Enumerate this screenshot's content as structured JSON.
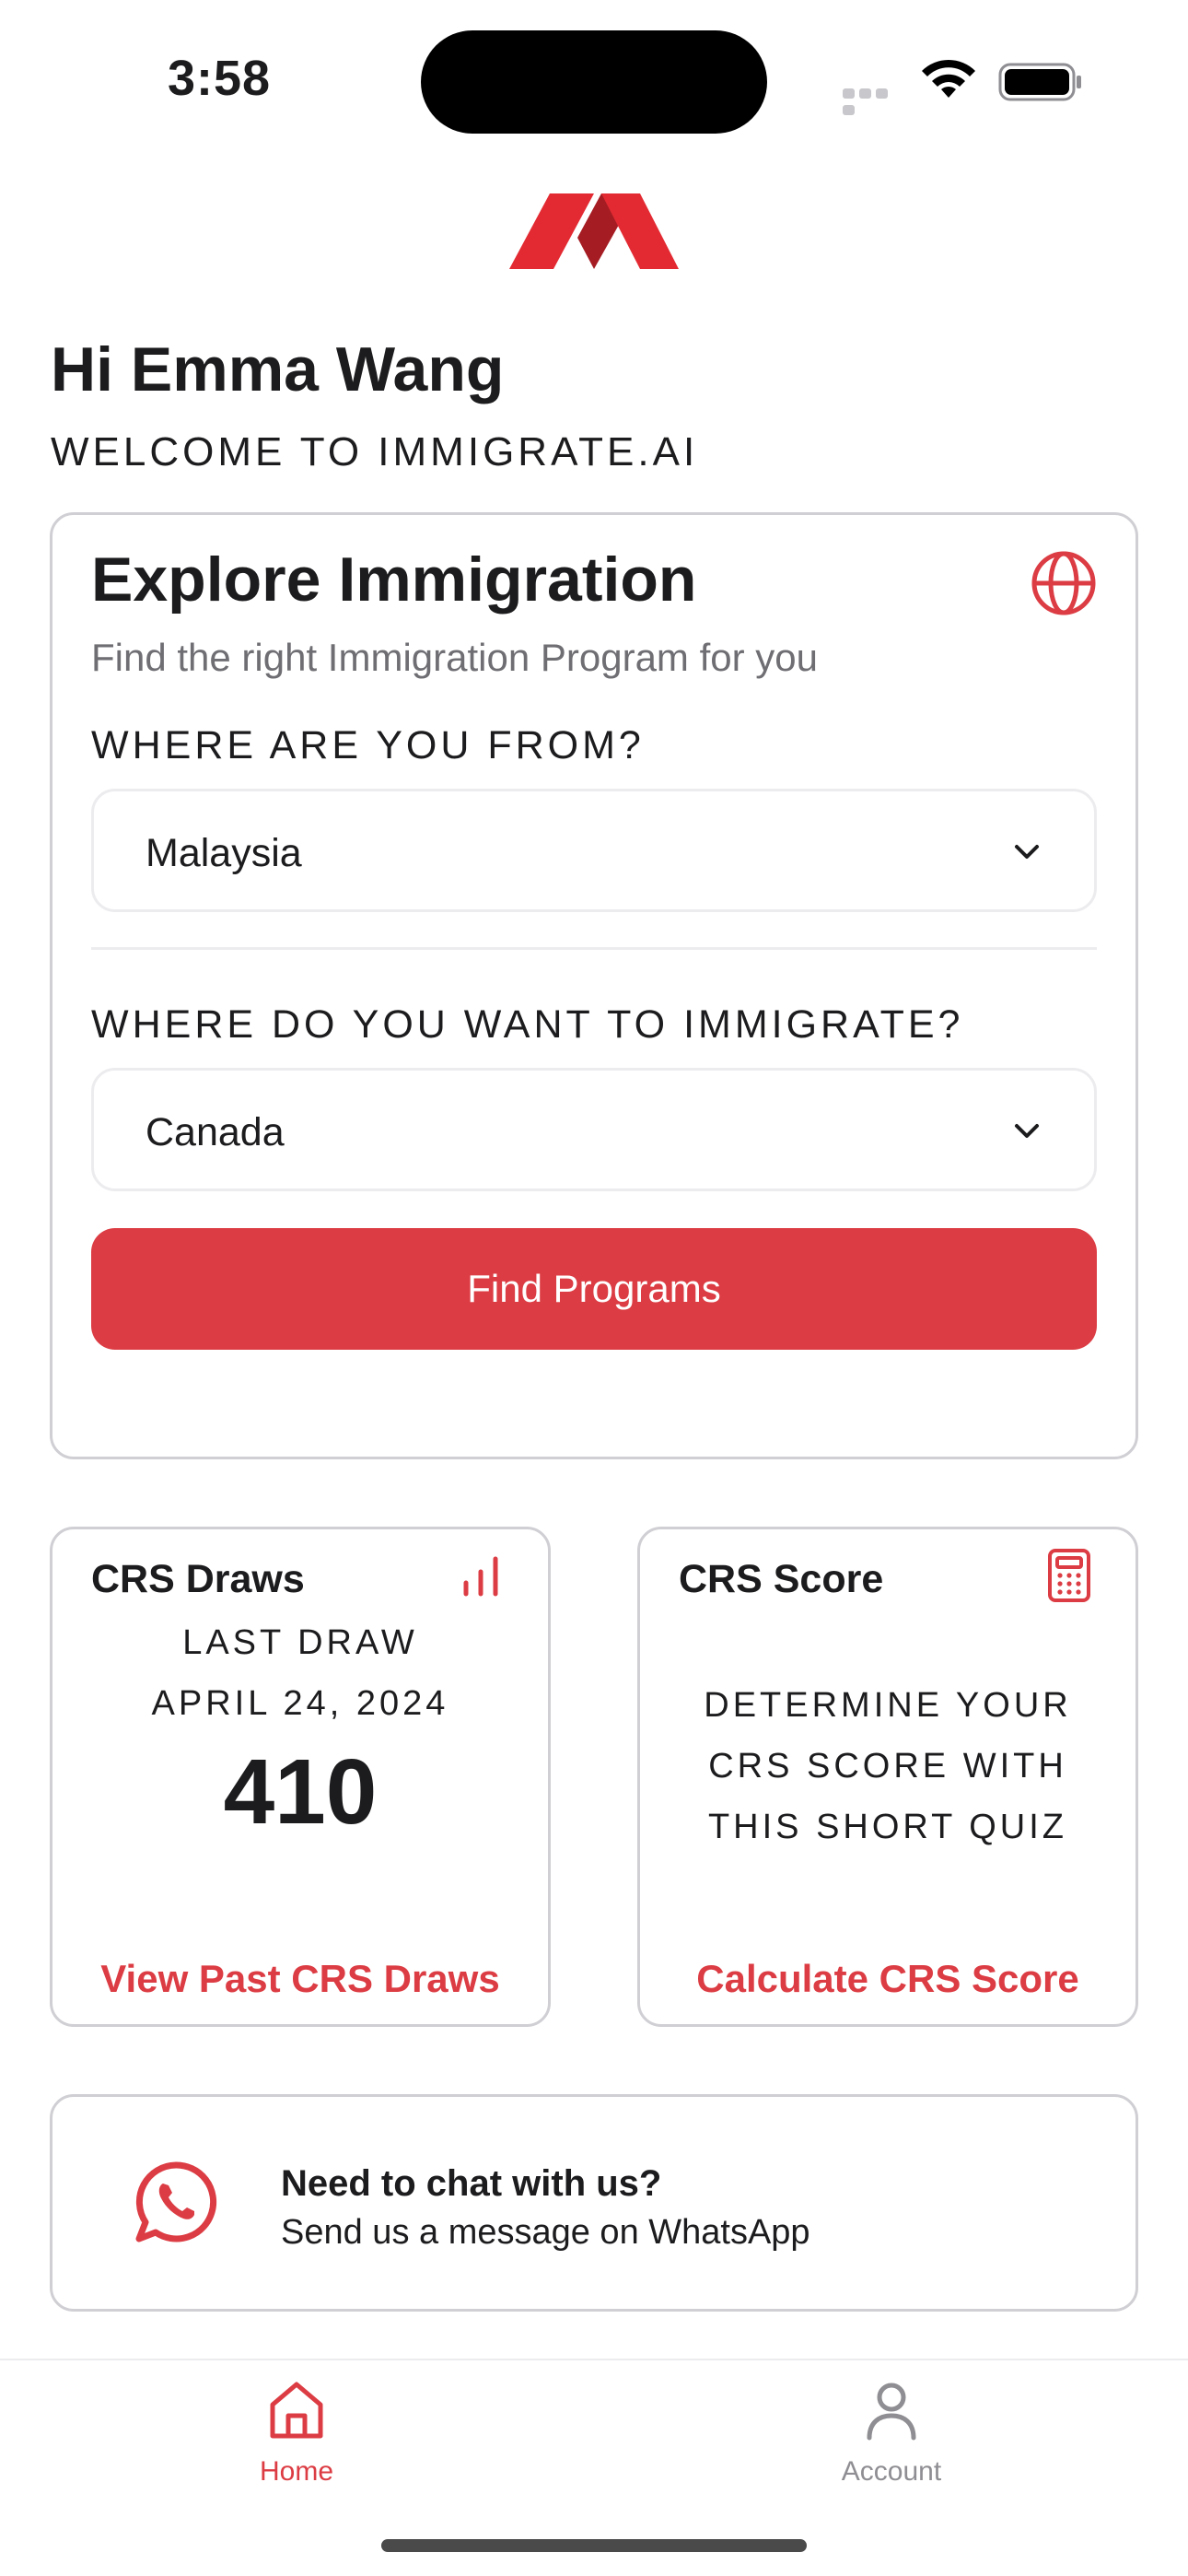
{
  "status_bar": {
    "time": "3:58"
  },
  "header": {
    "greeting": "Hi Emma Wang",
    "welcome": "WELCOME TO IMMIGRATE.AI"
  },
  "explore": {
    "title": "Explore Immigration",
    "subtitle": "Find the right Immigration Program for you",
    "from_label": "WHERE ARE YOU FROM?",
    "from_value": "Malaysia",
    "to_label": "WHERE DO YOU WANT TO IMMIGRATE?",
    "to_value": "Canada",
    "button_label": "Find Programs"
  },
  "crs_draws": {
    "title": "CRS Draws",
    "last_draw_label": "LAST DRAW",
    "date": "APRIL 24, 2024",
    "score": "410",
    "link": "View Past CRS Draws"
  },
  "crs_score": {
    "title": "CRS Score",
    "description": "DETERMINE YOUR CRS SCORE WITH THIS SHORT QUIZ",
    "link": "Calculate CRS Score"
  },
  "chat": {
    "title": "Need to chat with us?",
    "subtitle": "Send us a message on WhatsApp"
  },
  "tabs": [
    {
      "label": "Home",
      "icon": "home-icon",
      "active": true
    },
    {
      "label": "Account",
      "icon": "person-icon",
      "active": false
    }
  ],
  "colors": {
    "accent": "#dc3c43",
    "muted": "#8e8e93",
    "border": "#cfcfd4"
  }
}
